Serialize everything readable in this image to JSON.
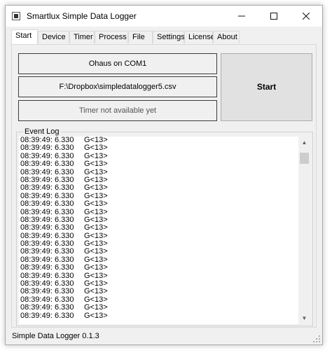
{
  "window": {
    "title": "Smartlux Simple Data Logger",
    "controls": {
      "minimize": "—",
      "maximize": "☐",
      "close": "✕"
    }
  },
  "tabs": [
    "Start",
    "Device",
    "Timer",
    "Process",
    "File",
    "Settings",
    "License",
    "About"
  ],
  "active_tab": "Start",
  "start_panel": {
    "device": "Ohaus on COM1",
    "file_path": "F:\\Dropbox\\simpledatalogger5.csv",
    "timer_status": "Timer not available yet",
    "start_label": "Start"
  },
  "event_log": {
    "label": "Event Log",
    "entries": [
      {
        "time": "08:39:49:",
        "value": "6.330",
        "code": "G<13>"
      },
      {
        "time": "08:39:49:",
        "value": "6.330",
        "code": "G<13>"
      },
      {
        "time": "08:39:49:",
        "value": "6.330",
        "code": "G<13>"
      },
      {
        "time": "08:39:49:",
        "value": "6.330",
        "code": "G<13>"
      },
      {
        "time": "08:39:49:",
        "value": "6.330",
        "code": "G<13>"
      },
      {
        "time": "08:39:49:",
        "value": "6.330",
        "code": "G<13>"
      },
      {
        "time": "08:39:49:",
        "value": "6.330",
        "code": "G<13>"
      },
      {
        "time": "08:39:49:",
        "value": "6.330",
        "code": "G<13>"
      },
      {
        "time": "08:39:49:",
        "value": "6.330",
        "code": "G<13>"
      },
      {
        "time": "08:39:49:",
        "value": "6.330",
        "code": "G<13>"
      },
      {
        "time": "08:39:49:",
        "value": "6.330",
        "code": "G<13>"
      },
      {
        "time": "08:39:49:",
        "value": "6.330",
        "code": "G<13>"
      },
      {
        "time": "08:39:49:",
        "value": "6.330",
        "code": "G<13>"
      },
      {
        "time": "08:39:49:",
        "value": "6.330",
        "code": "G<13>"
      },
      {
        "time": "08:39:49:",
        "value": "6.330",
        "code": "G<13>"
      },
      {
        "time": "08:39:49:",
        "value": "6.330",
        "code": "G<13>"
      },
      {
        "time": "08:39:49:",
        "value": "6.330",
        "code": "G<13>"
      },
      {
        "time": "08:39:49:",
        "value": "6.330",
        "code": "G<13>"
      },
      {
        "time": "08:39:49:",
        "value": "6.330",
        "code": "G<13>"
      },
      {
        "time": "08:39:49:",
        "value": "6.330",
        "code": "G<13>"
      },
      {
        "time": "08:39:49:",
        "value": "6.330",
        "code": "G<13>"
      },
      {
        "time": "08:39:49:",
        "value": "6.330",
        "code": "G<13>"
      },
      {
        "time": "08:39:49:",
        "value": "6.330",
        "code": "G<13>"
      }
    ]
  },
  "scrollbar": {
    "up_arrow": "▲",
    "down_arrow": "▼"
  },
  "status_bar": {
    "text": "Simple Data Logger 0.1.3"
  }
}
